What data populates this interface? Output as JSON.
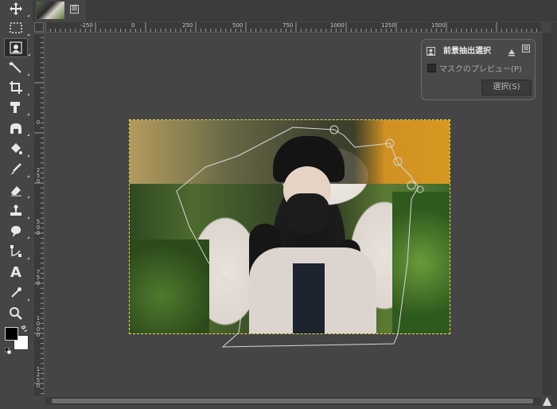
{
  "toolbox": {
    "tools": [
      {
        "name": "move-tool-icon"
      },
      {
        "name": "rect-select-tool-icon"
      },
      {
        "name": "foreground-select-tool-icon",
        "active": true
      },
      {
        "name": "fuzzy-select-tool-icon"
      },
      {
        "name": "crop-tool-icon"
      },
      {
        "name": "transform-tool-icon"
      },
      {
        "name": "warp-transform-tool-icon"
      },
      {
        "name": "bucket-fill-tool-icon"
      },
      {
        "name": "paintbrush-tool-icon"
      },
      {
        "name": "eraser-tool-icon"
      },
      {
        "name": "clone-tool-icon"
      },
      {
        "name": "smudge-tool-icon"
      },
      {
        "name": "paths-tool-icon"
      },
      {
        "name": "text-tool-icon",
        "glyph": "A"
      },
      {
        "name": "color-picker-tool-icon"
      },
      {
        "name": "zoom-tool-icon"
      }
    ],
    "foreground_color": "#000000",
    "background_color": "#ffffff"
  },
  "image_tab": {
    "thumbnail": "image-thumbnail",
    "close_glyph": "⊠"
  },
  "rulers": {
    "horizontal_labels": [
      "-250",
      "0",
      "250",
      "500",
      "750",
      "1000",
      "1250",
      "1500"
    ],
    "vertical_labels": [
      "0",
      "2 5 0",
      "5 0 0",
      "7 5 0",
      "1 0 0 0",
      "1 2 5 0"
    ]
  },
  "foreground_select_panel": {
    "title": "前景抽出選択",
    "preview_checkbox_label": "マスクのプレビュー(P)",
    "preview_checked": false,
    "select_button_label": "選択(S)",
    "close_glyph": "⊠"
  },
  "colors": {
    "selection_marching_ants": "#e8e24a",
    "ui_background": "#454545"
  }
}
